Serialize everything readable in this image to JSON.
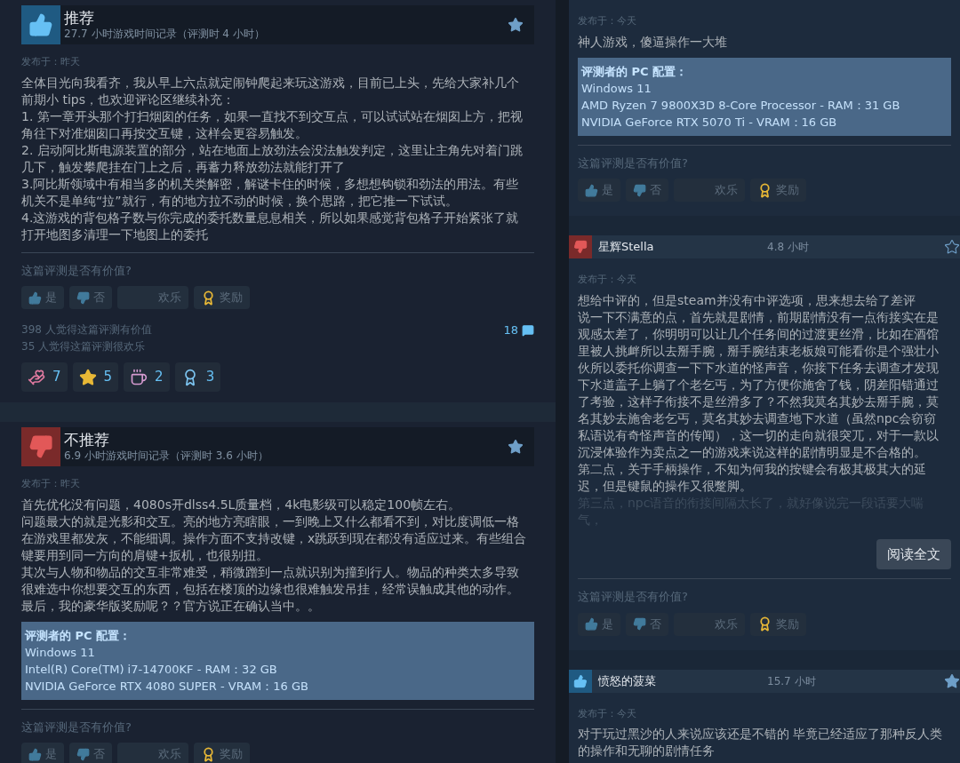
{
  "columns": [
    {
      "reviews": [
        {
          "kind": "full",
          "recommended": true,
          "title": "推荐",
          "playtime": "27.7 小时游戏时间记录（评测时 4 小时）",
          "favorited": true,
          "posted": "发布于：昨天",
          "paragraphs": [
            "全体目光向我看齐，我从早上六点就定闹钟爬起来玩这游戏，目前已上头，先给大家补几个前期小 tips，也欢迎评论区继续补充：",
            "1. 第一章开头那个打扫烟囱的任务，如果一直找不到交互点，可以试试站在烟囱上方，把视角往下对准烟囱口再按交互键，这样会更容易触发。",
            "2. 启动阿比斯电源装置的部分，站在地面上放劲法会没法触发判定，这里让主角先对着门跳几下，触发攀爬挂在门上之后，再蓄力释放劲法就能打开了",
            "3.阿比斯领域中有相当多的机关类解密，解谜卡住的时候，多想想钩锁和劲法的用法。有些机关不是单纯“拉”就行，有的地方拉不动的时候，换个思路，把它推一下试试。",
            "4.这游戏的背包格子数与你完成的委托数量息息相关，所以如果感觉背包格子开始紧张了就打开地图多清理一下地图上的委托"
          ],
          "prompt": "这篇评测是否有价值?",
          "votes": [
            {
              "kind": "up",
              "label": "是"
            },
            {
              "kind": "down",
              "label": "否"
            },
            {
              "kind": "funny",
              "label": "欢乐"
            },
            {
              "kind": "award",
              "label": "奖励"
            }
          ],
          "stats": [
            "398 人觉得这篇评测有价值",
            "35 人觉得这篇评测很欢乐"
          ],
          "comments": "18",
          "awards": [
            {
              "kind": "heart",
              "count": "7"
            },
            {
              "kind": "star",
              "count": "5"
            },
            {
              "kind": "cup",
              "count": "2"
            },
            {
              "kind": "ribbon",
              "count": "3"
            }
          ]
        },
        {
          "kind": "full",
          "recommended": false,
          "title": "不推荐",
          "playtime": "6.9 小时游戏时间记录（评测时 3.6 小时）",
          "favorited": true,
          "posted": "发布于：昨天",
          "paragraphs": [
            "首先优化没有问题，4080s开dlss4.5L质量档，4k电影级可以稳定100帧左右。",
            "问题最大的就是光影和交互。亮的地方亮瞎眼，一到晚上又什么都看不到，对比度调低一格在游戏里都发灰，不能细调。操作方面不支持改键，x跳跃到现在都没有适应过来。有些组合键要用到同一方向的肩键+扳机，也很别扭。",
            "其次与人物和物品的交互非常难受，稍微蹭到一点就识别为撞到行人。物品的种类太多导致很难选中你想要交互的东西，包括在楼顶的边缘也很难触发吊挂，经常误触成其他的动作。",
            "最后，我的豪华版奖励呢？？官方说正在确认当中。。"
          ],
          "specs": {
            "heading": "评测者的 PC 配置：",
            "lines": [
              "Windows 11",
              "Intel(R) Core(TM) i7-14700KF - RAM：32 GB",
              "NVIDIA GeForce RTX 4080 SUPER - VRAM：16 GB"
            ]
          },
          "prompt": "这篇评测是否有价值?",
          "votes": [
            {
              "kind": "up",
              "label": "是"
            },
            {
              "kind": "down",
              "label": "否"
            },
            {
              "kind": "funny",
              "label": "欢乐"
            },
            {
              "kind": "award",
              "label": "奖励"
            }
          ]
        }
      ]
    },
    {
      "reviews": [
        {
          "kind": "compact",
          "posted": "发布于：今天",
          "paragraphs": [
            "神人游戏，傻逼操作一大堆"
          ],
          "specs": {
            "heading": "评测者的 PC 配置：",
            "lines": [
              "Windows 11",
              "AMD Ryzen 7 9800X3D 8-Core Processor - RAM：31 GB",
              "NVIDIA GeForce RTX 5070 Ti - VRAM：16 GB"
            ]
          },
          "prompt": "这篇评测是否有价值?",
          "votes": [
            {
              "kind": "up",
              "label": "是"
            },
            {
              "kind": "down",
              "label": "否"
            },
            {
              "kind": "funny",
              "label": "欢乐"
            },
            {
              "kind": "award",
              "label": "奖励"
            }
          ]
        },
        {
          "kind": "compact",
          "recommended": false,
          "title": "星辉Stella",
          "playtime": "4.8 小时",
          "favorited": false,
          "posted": "发布于：今天",
          "paragraphs": [
            "想给中评的，但是steam并没有中评选项，思来想去给了差评",
            "说一下不满意的点，首先就是剧情，前期剧情没有一点衔接实在是观感太差了，你明明可以让几个任务间的过渡更丝滑，比如在酒馆里被人挑衅所以去掰手腕，掰手腕结束老板娘可能看你是个强壮小伙所以委托你调查一下下水道的怪声音，你接下任务去调查才发现下水道盖子上躺了个老乞丐，为了方便你施舍了钱，阴差阳错通过了考验，这样子衔接不是丝滑多了？不然我莫名其妙去掰手腕，莫名其妙去施舍老乞丐，莫名其妙去调查地下水道（虽然npc会窃窃私语说有奇怪声音的传闻），这一切的走向就很突兀，对于一款以沉浸体验作为卖点之一的游戏来说这样的剧情明显是不合格的。",
            "第二点，关于手柄操作，不知为何我的按键会有极其极其大的延迟，但是键鼠的操作又很蹩脚。"
          ],
          "faded_line": "第三点，npc语音的衔接间隔太长了，就好像说完一段话要大喘气，",
          "read_more": "阅读全文",
          "prompt": "这篇评测是否有价值?",
          "votes": [
            {
              "kind": "up",
              "label": "是"
            },
            {
              "kind": "down",
              "label": "否"
            },
            {
              "kind": "funny",
              "label": "欢乐"
            },
            {
              "kind": "award",
              "label": "奖励"
            }
          ]
        },
        {
          "kind": "compact",
          "recommended": true,
          "title": "愤怒的菠菜",
          "playtime": "15.7 小时",
          "favorited": true,
          "posted": "发布于：今天",
          "paragraphs": [
            "对于玩过黑沙的人来说应该还是不错的 毕竟已经适应了那种反人类的操作和无聊的剧情任务"
          ]
        }
      ]
    }
  ]
}
